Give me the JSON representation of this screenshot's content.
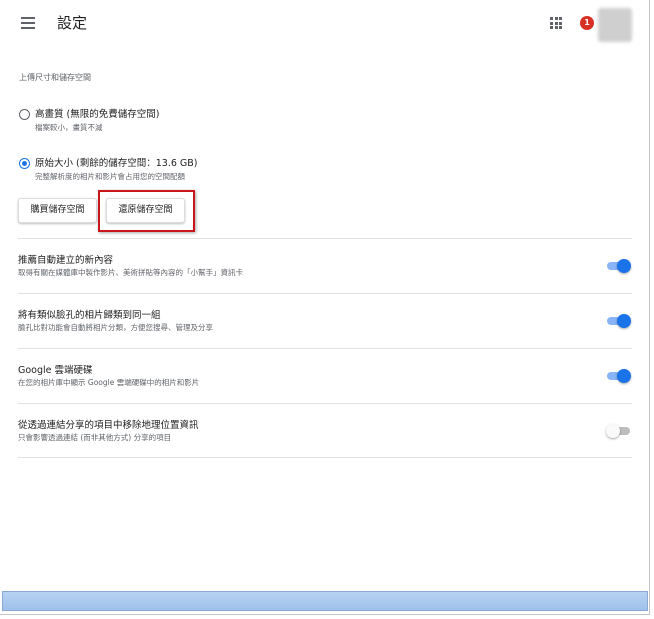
{
  "header": {
    "title": "設定",
    "notification_count": "1",
    "icons": [
      "menu-icon",
      "apps-icon",
      "avatar"
    ]
  },
  "upload": {
    "section_label": "上傳尺寸和儲存空間",
    "options": [
      {
        "title": "高畫質 (無限的免費儲存空間)",
        "subtitle": "檔案較小，畫質不減",
        "selected": false
      },
      {
        "title": "原始大小 (剩餘的儲存空間：13.6 GB)",
        "subtitle": "完整解析度的相片和影片會占用您的空間配額",
        "selected": true
      }
    ],
    "buy_button": "購買儲存空間",
    "restore_button": "還原儲存空間"
  },
  "settings": [
    {
      "title": "推薦自動建立的新內容",
      "subtitle": "取得有關在媒體庫中製作影片、美術拼貼等內容的「小幫手」資訊卡",
      "enabled": true
    },
    {
      "title": "將有類似臉孔的相片歸類到同一組",
      "subtitle": "臉孔比對功能會自動將相片分類，方便您搜尋、管理及分享",
      "enabled": true
    },
    {
      "title": "Google 雲端硬碟",
      "subtitle": "在您的相片庫中顯示 Google 雲端硬碟中的相片和影片",
      "enabled": true
    },
    {
      "title": "從透過連結分享的項目中移除地理位置資訊",
      "subtitle": "只會影響透過連結 (而非其他方式) 分享的項目",
      "enabled": false
    }
  ],
  "colors": {
    "accent": "#1a73e8",
    "highlight_box": "#c9161b",
    "notification_badge": "#d93025"
  }
}
